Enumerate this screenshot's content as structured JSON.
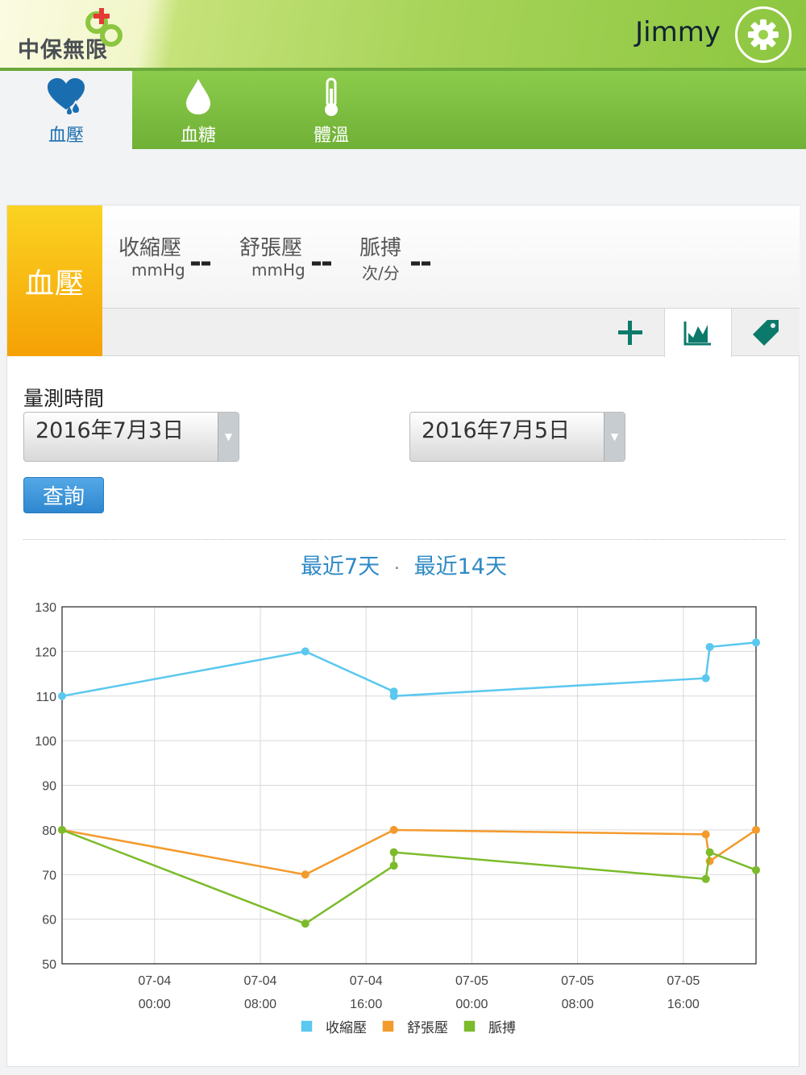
{
  "header": {
    "logo_text": "中保無限",
    "user_name": "Jimmy"
  },
  "tabs": [
    {
      "label": "血壓",
      "icon": "heart-drop-icon",
      "active": true
    },
    {
      "label": "血糖",
      "icon": "drop-icon",
      "active": false
    },
    {
      "label": "體溫",
      "icon": "thermometer-icon",
      "active": false
    }
  ],
  "panel": {
    "badge": "血壓",
    "metrics": [
      {
        "label": "收縮壓",
        "unit": "mmHg",
        "value": "--"
      },
      {
        "label": "舒張壓",
        "unit": "mmHg",
        "value": "--"
      },
      {
        "label": "脈搏",
        "unit": "次/分",
        "value": "--"
      }
    ],
    "tools": [
      "add-icon",
      "chart-icon",
      "tag-icon"
    ]
  },
  "query": {
    "title": "量測時間",
    "start_date": "2016年7月3日",
    "end_date": "2016年7月5日",
    "button": "查詢",
    "range_7": "最近7天",
    "range_sep": "·",
    "range_14": "最近14天"
  },
  "colors": {
    "systolic": "#5bc8ef",
    "diastolic": "#f39a2d",
    "pulse": "#7cbb2c",
    "link": "#2e8ac6"
  },
  "chart_data": {
    "type": "line",
    "ylim": [
      50,
      130
    ],
    "yticks": [
      130,
      120,
      110,
      100,
      90,
      80,
      70,
      60,
      50
    ],
    "xlim_hours": [
      -7,
      45.5
    ],
    "x_ticks": [
      {
        "date": "07-04",
        "time": "00:00",
        "h": 0
      },
      {
        "date": "07-04",
        "time": "08:00",
        "h": 8
      },
      {
        "date": "07-04",
        "time": "16:00",
        "h": 16
      },
      {
        "date": "07-05",
        "time": "00:00",
        "h": 24
      },
      {
        "date": "07-05",
        "time": "08:00",
        "h": 32
      },
      {
        "date": "07-05",
        "time": "16:00",
        "h": 40
      }
    ],
    "series": [
      {
        "name": "收縮壓",
        "color": "#5bc8ef",
        "points": [
          [
            -7,
            110
          ],
          [
            11.4,
            120
          ],
          [
            18.1,
            111
          ],
          [
            18.1,
            110
          ],
          [
            41.7,
            114
          ],
          [
            42.0,
            121
          ],
          [
            45.5,
            122
          ]
        ]
      },
      {
        "name": "舒張壓",
        "color": "#f39a2d",
        "points": [
          [
            -7,
            80
          ],
          [
            11.4,
            70
          ],
          [
            18.1,
            80
          ],
          [
            41.7,
            79
          ],
          [
            42.0,
            73
          ],
          [
            45.5,
            80
          ]
        ]
      },
      {
        "name": "脈搏",
        "color": "#7cbb2c",
        "points": [
          [
            -7,
            80
          ],
          [
            11.4,
            59
          ],
          [
            18.1,
            72
          ],
          [
            18.1,
            75
          ],
          [
            41.7,
            69
          ],
          [
            42.0,
            75
          ],
          [
            45.5,
            71
          ]
        ]
      }
    ]
  }
}
